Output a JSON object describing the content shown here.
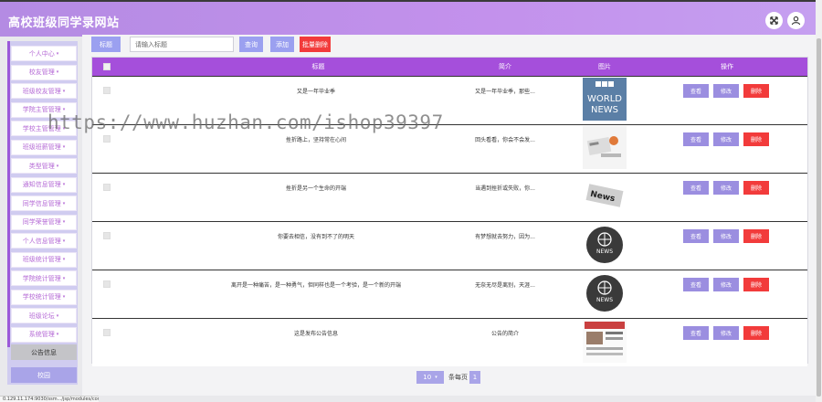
{
  "app": {
    "title": "高校班级同学录网站"
  },
  "sidebar": {
    "items": [
      {
        "label": "个人中心"
      },
      {
        "label": "校友管理"
      },
      {
        "label": "班级校友管理"
      },
      {
        "label": "学院主管管理"
      },
      {
        "label": "学校主管管理"
      },
      {
        "label": "班级班薪管理"
      },
      {
        "label": "类型管理"
      },
      {
        "label": "通知信息管理"
      },
      {
        "label": "同学信息管理"
      },
      {
        "label": "同学荣誉管理"
      },
      {
        "label": "个人信息管理"
      },
      {
        "label": "班级统计管理"
      },
      {
        "label": "学院统计管理"
      },
      {
        "label": "学校统计管理"
      },
      {
        "label": "班级论坛"
      },
      {
        "label": "系统管理"
      }
    ],
    "active_item": "公告信息",
    "bottom_item": "校园"
  },
  "toolbar": {
    "title_label": "标题",
    "search_placeholder": "请输入标题",
    "query_label": "查询",
    "add_label": "添加",
    "batch_delete_label": "批量删除",
    "accent": "#9ba0f0",
    "danger": "#f23b3b"
  },
  "table": {
    "headers": {
      "title": "标题",
      "brief": "简介",
      "image": "图片",
      "actions": "操作"
    },
    "rows": [
      {
        "title": "又是一年毕业季",
        "brief": "又是一年毕业季，那些...",
        "image": "bbc-world-news"
      },
      {
        "title": "挫折路上，坚持常在心间",
        "brief": "回头看看，你会不会发...",
        "image": "news-desk"
      },
      {
        "title": "挫折是另一个生命的开端",
        "brief": "当遇到挫折或失败，你...",
        "image": "newspaper"
      },
      {
        "title": "你要去相信，没有到不了的明天",
        "brief": "有梦想就去努力，因为...",
        "image": "news-globe"
      },
      {
        "title": "离开是一种痛苦，是一种勇气，但同样也是一个考验，是一个新的开端",
        "brief": "无奈无尽是离别，天涯...",
        "image": "news-globe"
      },
      {
        "title": "这是发布公告信息",
        "brief": "公告的简介",
        "image": "newspaper-front"
      }
    ],
    "actions": {
      "view": "查看",
      "edit": "修改",
      "delete": "删除"
    }
  },
  "pagination": {
    "page_size": "10",
    "jump_text": "条每页",
    "current_page": "1"
  },
  "status_url": "0.129.11.174:9030/ssm.../jsp/modules/config/list.jsp",
  "watermark": "https://www.huzhan.com/ishop39397"
}
